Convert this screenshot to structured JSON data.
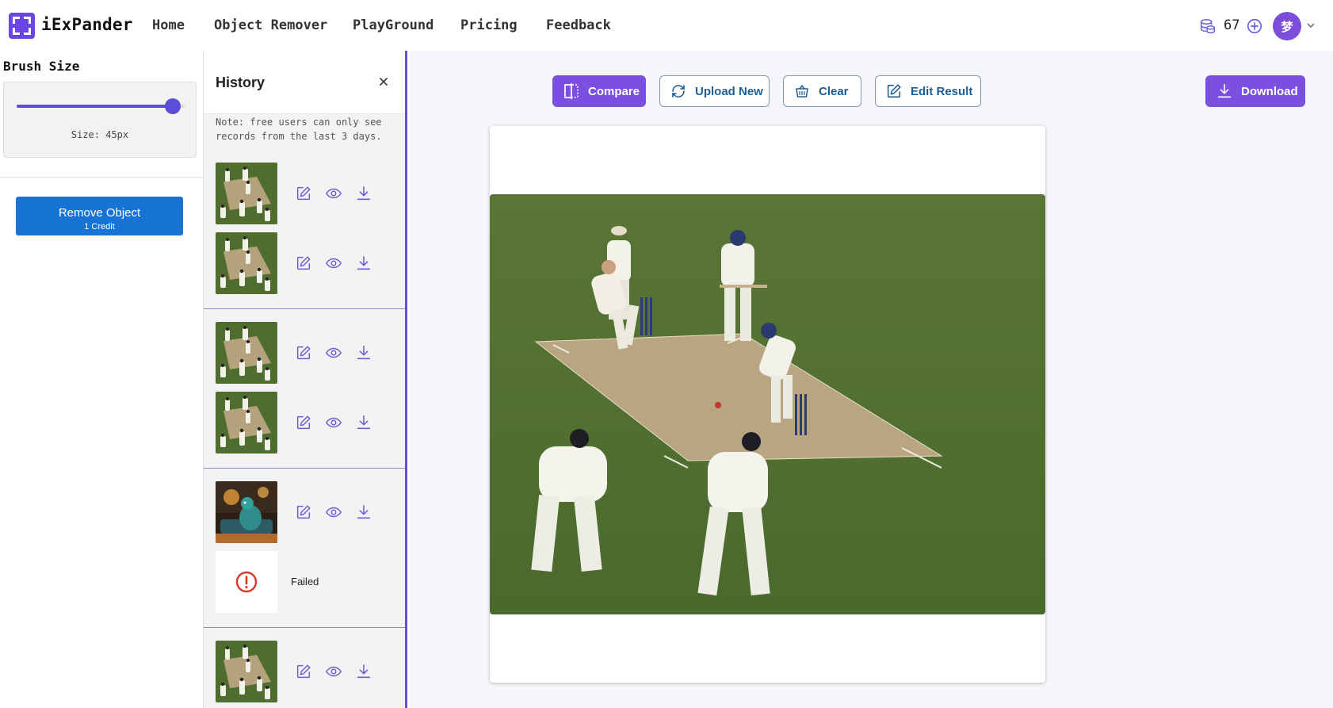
{
  "app": {
    "name": "iExPander"
  },
  "nav": [
    {
      "label": "Home"
    },
    {
      "label": "Object Remover"
    },
    {
      "label": "PlayGround"
    },
    {
      "label": "Pricing"
    },
    {
      "label": "Feedback"
    }
  ],
  "account": {
    "credits": "67",
    "avatar_char": "梦"
  },
  "brush": {
    "title": "Brush Size",
    "size_label": "Size: 45px",
    "level_fraction": 0.93
  },
  "remove_button": {
    "label": "Remove Object",
    "sub": "1 Credit"
  },
  "history": {
    "title": "History",
    "note": "Note: free users can only see records from the last 3 days.",
    "failed_label": "Failed"
  },
  "toolbar": {
    "compare": "Compare",
    "upload_new": "Upload New",
    "clear": "Clear",
    "edit_result": "Edit Result",
    "download": "Download"
  },
  "colors": {
    "brand": "#6b46e5",
    "primary_blue": "#1874d4",
    "accent_purple": "#7b4fe0",
    "outline_text": "#1f5e91",
    "failed_red": "#d33b2c",
    "grass": "#4f6f2f",
    "pitch": "#b9a582"
  }
}
